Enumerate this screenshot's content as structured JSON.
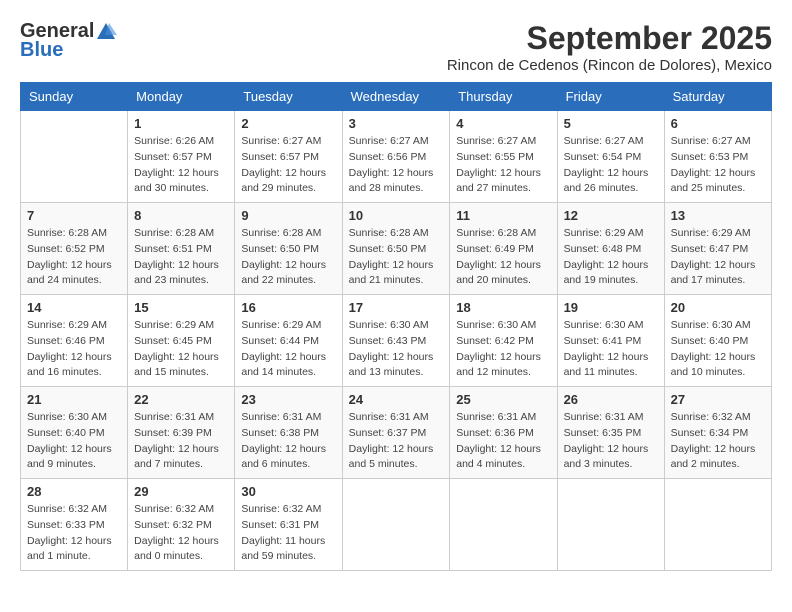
{
  "logo": {
    "general": "General",
    "blue": "Blue"
  },
  "title": "September 2025",
  "location": "Rincon de Cedenos (Rincon de Dolores), Mexico",
  "days_of_week": [
    "Sunday",
    "Monday",
    "Tuesday",
    "Wednesday",
    "Thursday",
    "Friday",
    "Saturday"
  ],
  "weeks": [
    [
      {
        "day": "",
        "info": ""
      },
      {
        "day": "1",
        "info": "Sunrise: 6:26 AM\nSunset: 6:57 PM\nDaylight: 12 hours\nand 30 minutes."
      },
      {
        "day": "2",
        "info": "Sunrise: 6:27 AM\nSunset: 6:57 PM\nDaylight: 12 hours\nand 29 minutes."
      },
      {
        "day": "3",
        "info": "Sunrise: 6:27 AM\nSunset: 6:56 PM\nDaylight: 12 hours\nand 28 minutes."
      },
      {
        "day": "4",
        "info": "Sunrise: 6:27 AM\nSunset: 6:55 PM\nDaylight: 12 hours\nand 27 minutes."
      },
      {
        "day": "5",
        "info": "Sunrise: 6:27 AM\nSunset: 6:54 PM\nDaylight: 12 hours\nand 26 minutes."
      },
      {
        "day": "6",
        "info": "Sunrise: 6:27 AM\nSunset: 6:53 PM\nDaylight: 12 hours\nand 25 minutes."
      }
    ],
    [
      {
        "day": "7",
        "info": "Sunrise: 6:28 AM\nSunset: 6:52 PM\nDaylight: 12 hours\nand 24 minutes."
      },
      {
        "day": "8",
        "info": "Sunrise: 6:28 AM\nSunset: 6:51 PM\nDaylight: 12 hours\nand 23 minutes."
      },
      {
        "day": "9",
        "info": "Sunrise: 6:28 AM\nSunset: 6:50 PM\nDaylight: 12 hours\nand 22 minutes."
      },
      {
        "day": "10",
        "info": "Sunrise: 6:28 AM\nSunset: 6:50 PM\nDaylight: 12 hours\nand 21 minutes."
      },
      {
        "day": "11",
        "info": "Sunrise: 6:28 AM\nSunset: 6:49 PM\nDaylight: 12 hours\nand 20 minutes."
      },
      {
        "day": "12",
        "info": "Sunrise: 6:29 AM\nSunset: 6:48 PM\nDaylight: 12 hours\nand 19 minutes."
      },
      {
        "day": "13",
        "info": "Sunrise: 6:29 AM\nSunset: 6:47 PM\nDaylight: 12 hours\nand 17 minutes."
      }
    ],
    [
      {
        "day": "14",
        "info": "Sunrise: 6:29 AM\nSunset: 6:46 PM\nDaylight: 12 hours\nand 16 minutes."
      },
      {
        "day": "15",
        "info": "Sunrise: 6:29 AM\nSunset: 6:45 PM\nDaylight: 12 hours\nand 15 minutes."
      },
      {
        "day": "16",
        "info": "Sunrise: 6:29 AM\nSunset: 6:44 PM\nDaylight: 12 hours\nand 14 minutes."
      },
      {
        "day": "17",
        "info": "Sunrise: 6:30 AM\nSunset: 6:43 PM\nDaylight: 12 hours\nand 13 minutes."
      },
      {
        "day": "18",
        "info": "Sunrise: 6:30 AM\nSunset: 6:42 PM\nDaylight: 12 hours\nand 12 minutes."
      },
      {
        "day": "19",
        "info": "Sunrise: 6:30 AM\nSunset: 6:41 PM\nDaylight: 12 hours\nand 11 minutes."
      },
      {
        "day": "20",
        "info": "Sunrise: 6:30 AM\nSunset: 6:40 PM\nDaylight: 12 hours\nand 10 minutes."
      }
    ],
    [
      {
        "day": "21",
        "info": "Sunrise: 6:30 AM\nSunset: 6:40 PM\nDaylight: 12 hours\nand 9 minutes."
      },
      {
        "day": "22",
        "info": "Sunrise: 6:31 AM\nSunset: 6:39 PM\nDaylight: 12 hours\nand 7 minutes."
      },
      {
        "day": "23",
        "info": "Sunrise: 6:31 AM\nSunset: 6:38 PM\nDaylight: 12 hours\nand 6 minutes."
      },
      {
        "day": "24",
        "info": "Sunrise: 6:31 AM\nSunset: 6:37 PM\nDaylight: 12 hours\nand 5 minutes."
      },
      {
        "day": "25",
        "info": "Sunrise: 6:31 AM\nSunset: 6:36 PM\nDaylight: 12 hours\nand 4 minutes."
      },
      {
        "day": "26",
        "info": "Sunrise: 6:31 AM\nSunset: 6:35 PM\nDaylight: 12 hours\nand 3 minutes."
      },
      {
        "day": "27",
        "info": "Sunrise: 6:32 AM\nSunset: 6:34 PM\nDaylight: 12 hours\nand 2 minutes."
      }
    ],
    [
      {
        "day": "28",
        "info": "Sunrise: 6:32 AM\nSunset: 6:33 PM\nDaylight: 12 hours\nand 1 minute."
      },
      {
        "day": "29",
        "info": "Sunrise: 6:32 AM\nSunset: 6:32 PM\nDaylight: 12 hours\nand 0 minutes."
      },
      {
        "day": "30",
        "info": "Sunrise: 6:32 AM\nSunset: 6:31 PM\nDaylight: 11 hours\nand 59 minutes."
      },
      {
        "day": "",
        "info": ""
      },
      {
        "day": "",
        "info": ""
      },
      {
        "day": "",
        "info": ""
      },
      {
        "day": "",
        "info": ""
      }
    ]
  ]
}
